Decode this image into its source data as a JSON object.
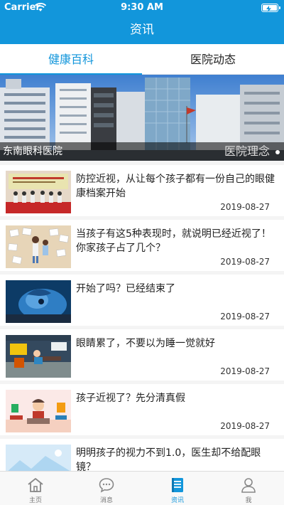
{
  "status_bar": {
    "carrier": "Carrier",
    "time": "9:30 AM"
  },
  "nav": {
    "title": "资讯"
  },
  "tabs": [
    {
      "label": "健康百科",
      "active": true
    },
    {
      "label": "医院动态",
      "active": false
    }
  ],
  "banner": {
    "caption": "东南眼科医院",
    "watermark": "医院理念"
  },
  "articles": [
    {
      "title": "防控近视，从让每个孩子都有一份自己的眼健康档案开始",
      "date": "2019-08-27"
    },
    {
      "title": "当孩子有这5种表现时，就说明已经近视了！你家孩子占了几个？",
      "date": "2019-08-27"
    },
    {
      "title": "开始了吗？已经结束了",
      "date": "2019-08-27"
    },
    {
      "title": "眼睛累了，不要以为睡一觉就好",
      "date": "2019-08-27"
    },
    {
      "title": "孩子近视了？先分清真假",
      "date": "2019-08-27"
    },
    {
      "title": "明明孩子的视力不到1.0，医生却不给配眼镜？",
      "date": ""
    }
  ],
  "tabbar": [
    {
      "label": "主页",
      "icon": "home-icon",
      "active": false
    },
    {
      "label": "消息",
      "icon": "message-icon",
      "active": false
    },
    {
      "label": "资讯",
      "icon": "news-icon",
      "active": true
    },
    {
      "label": "我",
      "icon": "profile-icon",
      "active": false
    }
  ],
  "colors": {
    "primary": "#1296db",
    "tab_inactive": "#777777"
  }
}
